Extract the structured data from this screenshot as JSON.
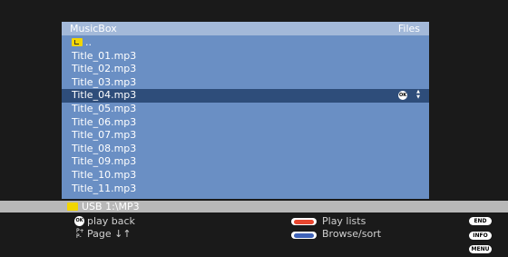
{
  "header": {
    "title": "MusicBox",
    "right": "Files"
  },
  "files": [
    {
      "label": "..",
      "type": "parent"
    },
    {
      "label": "Title_01.mp3"
    },
    {
      "label": "Title_02.mp3"
    },
    {
      "label": "Title_03.mp3"
    },
    {
      "label": "Title_04.mp3",
      "selected": true
    },
    {
      "label": "Title_05.mp3"
    },
    {
      "label": "Title_06.mp3"
    },
    {
      "label": "Title_07.mp3"
    },
    {
      "label": "Title_08.mp3"
    },
    {
      "label": "Title_09.mp3"
    },
    {
      "label": "Title_10.mp3"
    },
    {
      "label": "Title_11.mp3"
    }
  ],
  "path": "USB 1:\\MP3",
  "legend": {
    "ok_glyph": "OK",
    "play_back": "play back",
    "page_glyph": "P+\nP-",
    "page": "Page ↓↑",
    "play_lists": "Play lists",
    "browse_sort": "Browse/sort",
    "end": "END",
    "info": "INFO",
    "menu": "MENU"
  },
  "colors": {
    "panel": "#6a8fc4",
    "header": "#a3b9d9",
    "selected_row": "#2e4d7a",
    "red_key": "#e8462f",
    "blue_key": "#3f63b8",
    "folder": "#f2d600"
  }
}
